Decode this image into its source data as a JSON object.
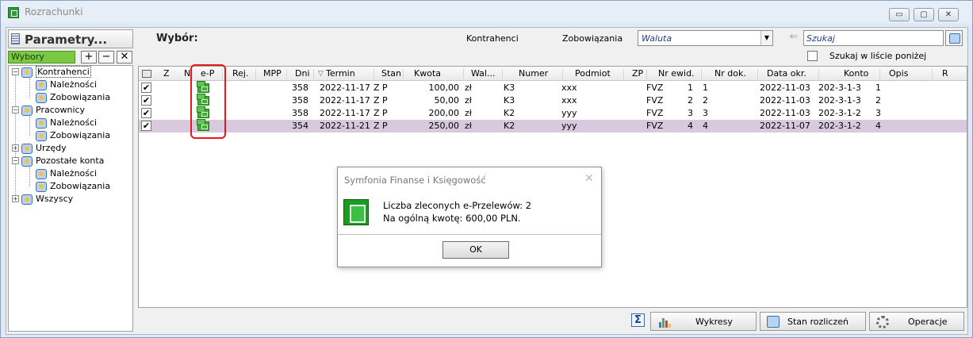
{
  "window": {
    "title": "Rozrachunki",
    "buttons": [
      "▭",
      "▢",
      "✕"
    ]
  },
  "left_panel": {
    "title": "Parametry...",
    "wybory_label": "Wybory",
    "wybory_buttons": [
      "+",
      "−",
      "✕"
    ],
    "tree": [
      {
        "label": "Kontrahenci",
        "level": 0,
        "expander": "⊟"
      },
      {
        "label": "Należności",
        "level": 1
      },
      {
        "label": "Zobowiązania",
        "level": 1
      },
      {
        "label": "Pracownicy",
        "level": 0,
        "expander": "⊟"
      },
      {
        "label": "Należności",
        "level": 1
      },
      {
        "label": "Zobowiązania",
        "level": 1
      },
      {
        "label": "Urzędy",
        "level": 0,
        "expander": "⊞"
      },
      {
        "label": "Pozostałe konta",
        "level": 0,
        "expander": "⊟"
      },
      {
        "label": "Należności",
        "level": 1
      },
      {
        "label": "Zobowiązania",
        "level": 1
      },
      {
        "label": "Wszyscy",
        "level": 0,
        "expander": "⊞"
      }
    ]
  },
  "filter": {
    "wybor_label": "Wybór:",
    "kontrahenci_label": "Kontrahenci",
    "zobowiazania_label": "Zobowiązania",
    "waluta_value": "Waluta",
    "search_placeholder": "Szukaj",
    "search_list_label": "Szukaj w liście poniżej"
  },
  "grid": {
    "columns": [
      "Z",
      "N",
      "e-P",
      "Rej.",
      "MPP",
      "Dni",
      "Termin",
      "Stan",
      "Kwota",
      "Wal...",
      "Numer",
      "Podmiot",
      "ZP",
      "Nr ewid.",
      "Nr dok.",
      "Data okr.",
      "Konto",
      "Opis",
      "R"
    ],
    "sort_marker": "▽",
    "rows": [
      {
        "check": "✔",
        "dni": "358",
        "termin": "2022-11-17",
        "stan": "Z P",
        "kwota": "100,00",
        "wal": "zł",
        "numer": "K3",
        "podmiot": "xxx",
        "zp": "FVZ",
        "nr_ewid": "1",
        "nr_dok": "1",
        "data_okr": "2022-11-03",
        "konto": "202-3-1-3",
        "opis": "1",
        "selected": false
      },
      {
        "check": "✔",
        "dni": "358",
        "termin": "2022-11-17",
        "stan": "Z P",
        "kwota": "50,00",
        "wal": "zł",
        "numer": "K3",
        "podmiot": "xxx",
        "zp": "FVZ",
        "nr_ewid": "2",
        "nr_dok": "2",
        "data_okr": "2022-11-03",
        "konto": "202-3-1-3",
        "opis": "2",
        "selected": false
      },
      {
        "check": "✔",
        "dni": "358",
        "termin": "2022-11-17",
        "stan": "Z P",
        "kwota": "200,00",
        "wal": "zł",
        "numer": "K2",
        "podmiot": "yyy",
        "zp": "FVZ",
        "nr_ewid": "3",
        "nr_dok": "3",
        "data_okr": "2022-11-03",
        "konto": "202-3-1-2",
        "opis": "3",
        "selected": false
      },
      {
        "check": "✔",
        "dni": "354",
        "termin": "2022-11-21",
        "stan": "Z P",
        "kwota": "250,00",
        "wal": "zł",
        "numer": "K2",
        "podmiot": "yyy",
        "zp": "FVZ",
        "nr_ewid": "4",
        "nr_dok": "4",
        "data_okr": "2022-11-07",
        "konto": "202-3-1-2",
        "opis": "4",
        "selected": true
      }
    ]
  },
  "bottom": {
    "sigma": "Σ",
    "wykresy": "Wykresy",
    "stan_rozliczen": "Stan rozliczeń",
    "operacje": "Operacje"
  },
  "dialog": {
    "title": "Symfonia Finanse i Księgowość",
    "close": "✕",
    "line1": "Liczba zleconych e-Przelewów: 2",
    "line2": "Na ogólną kwotę: 600,00 PLN.",
    "ok": "OK"
  },
  "colors": {
    "highlight": "#e11b1b",
    "selected_row": "#d8c9df",
    "wybory_tab": "#7ac943",
    "eprzelew_icon": "#3fae32"
  }
}
